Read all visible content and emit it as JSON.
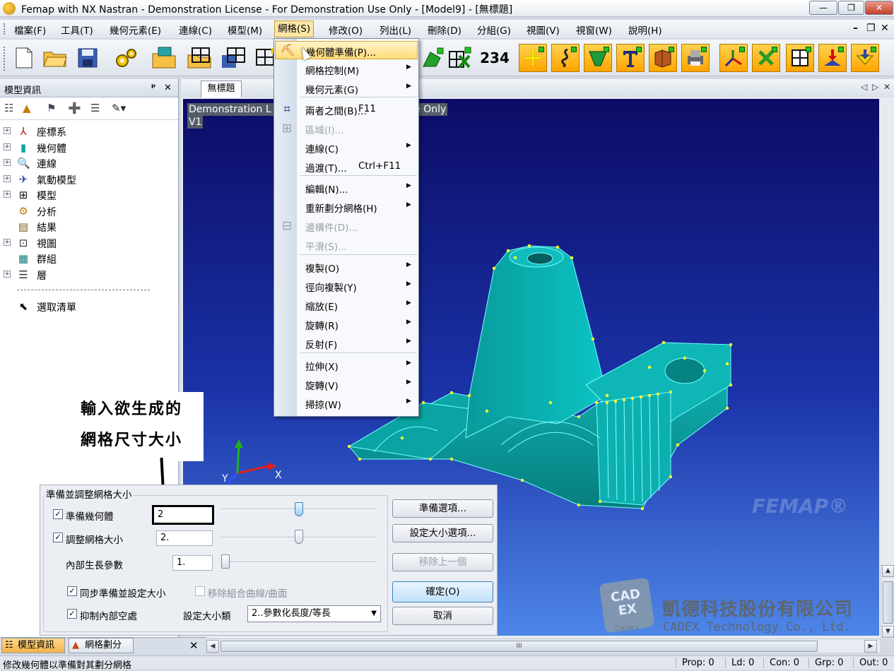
{
  "titlebar": {
    "title": "Femap with NX Nastran - Demonstration License - For Demonstration Use Only - [Model9] - [無標題]",
    "min": "—",
    "max": "❐",
    "close": "✕"
  },
  "menubar": {
    "items": [
      "檔案(F)",
      "工具(T)",
      "幾何元素(E)",
      "連線(C)",
      "模型(M)",
      "網格(S)",
      "修改(O)",
      "列出(L)",
      "刪除(D)",
      "分組(G)",
      "視圖(V)",
      "視窗(W)",
      "說明(H)"
    ],
    "active": "網格(S)",
    "mdi_min": "–",
    "mdi_restore": "❐",
    "mdi_close": "✕"
  },
  "toolbar": {
    "numbers_button": "234"
  },
  "left_panel": {
    "title": "模型資訊",
    "pin": "ᵖ",
    "close": "✕",
    "tree": [
      {
        "label": "座標系",
        "expandable": true
      },
      {
        "label": "幾何體",
        "expandable": true
      },
      {
        "label": "連線",
        "expandable": true
      },
      {
        "label": "氣動模型",
        "expandable": true
      },
      {
        "label": "模型",
        "expandable": true
      },
      {
        "label": "分析",
        "expandable": false
      },
      {
        "label": "結果",
        "expandable": false
      },
      {
        "label": "視圖",
        "expandable": true
      },
      {
        "label": "群組",
        "expandable": false
      },
      {
        "label": "層",
        "expandable": true
      },
      {
        "label": "",
        "separator": true
      },
      {
        "label": "選取清單",
        "expandable": false
      }
    ]
  },
  "viewport": {
    "tab": "無標題",
    "demo_line1": "Demonstration L",
    "demo_line1_right": "Use Only",
    "demo_line2": "V1",
    "axis_x": "X",
    "axis_y": "Y",
    "watermark": "FEMAP®",
    "colors": {
      "model": "#0aa8a8",
      "edges": "#ffff33"
    }
  },
  "mesh_menu": {
    "items": [
      {
        "label": "幾何體準備(P)...",
        "shortcut": "",
        "submenu": false,
        "disabled": false,
        "highlighted": true,
        "icon": "geometry-prep-icon"
      },
      {
        "label": "網格控制(M)",
        "shortcut": "",
        "submenu": true,
        "disabled": false
      },
      {
        "label": "幾何元素(G)",
        "shortcut": "",
        "submenu": true,
        "disabled": false
      },
      {
        "label": "兩者之間(B)...",
        "shortcut": "F11",
        "submenu": false,
        "disabled": false,
        "icon": "between-icon"
      },
      {
        "label": "區域(I)...",
        "shortcut": "",
        "submenu": false,
        "disabled": true,
        "icon": "region-icon"
      },
      {
        "label": "連線(C)",
        "shortcut": "",
        "submenu": true,
        "disabled": false
      },
      {
        "label": "過渡(T)...",
        "shortcut": "Ctrl+F11",
        "submenu": false,
        "disabled": false
      },
      {
        "label": "編輯(N)...",
        "shortcut": "",
        "submenu": true,
        "disabled": false
      },
      {
        "label": "重新劃分網格(H)",
        "shortcut": "",
        "submenu": true,
        "disabled": false
      },
      {
        "label": "邊構件(D)...",
        "shortcut": "",
        "submenu": false,
        "disabled": true,
        "icon": "edge-member-icon"
      },
      {
        "label": "平滑(S)...",
        "shortcut": "",
        "submenu": false,
        "disabled": true
      },
      {
        "label": "複製(O)",
        "shortcut": "",
        "submenu": true,
        "disabled": false
      },
      {
        "label": "徑向複製(Y)",
        "shortcut": "",
        "submenu": true,
        "disabled": false
      },
      {
        "label": "縮放(E)",
        "shortcut": "",
        "submenu": true,
        "disabled": false
      },
      {
        "label": "旋轉(R)",
        "shortcut": "",
        "submenu": true,
        "disabled": false
      },
      {
        "label": "反射(F)",
        "shortcut": "",
        "submenu": true,
        "disabled": false
      },
      {
        "label": "拉伸(X)",
        "shortcut": "",
        "submenu": true,
        "disabled": false
      },
      {
        "label": "旋轉(V)",
        "shortcut": "",
        "submenu": true,
        "disabled": false
      },
      {
        "label": "掃掠(W)",
        "shortcut": "",
        "submenu": true,
        "disabled": false
      }
    ]
  },
  "annotation": {
    "line1": "輸入欲生成的",
    "line2": "網格尺寸大小"
  },
  "dialog": {
    "group_title": "準備並調整網格大小",
    "prep_geometry": {
      "label": "準備幾何體",
      "checked": true,
      "value": "2",
      "slider_fraction": 0.5
    },
    "size_mesh": {
      "label": "調整網格大小",
      "checked": true,
      "value": "2.",
      "slider_fraction": 0.5
    },
    "growth": {
      "label": "內部生長參數",
      "value": "1.",
      "slider_fraction": 0.0
    },
    "sync": {
      "label": "同步準備並設定大小",
      "checked": true
    },
    "remove_combined": {
      "label": "移除組合曲線/曲面",
      "checked": false,
      "disabled": true
    },
    "suppress": {
      "label": "抑制內部空處",
      "checked": true
    },
    "sizing_type_label": "設定大小類",
    "sizing_type_value": "2..參數化長度/等長",
    "buttons": {
      "prep_options": "準備選項...",
      "size_options": "設定大小選項...",
      "remove_last": "移除上一個",
      "ok": "確定(O)",
      "cancel": "取消"
    }
  },
  "logo": {
    "mark": "CAD EX",
    "mark_small": "CADEX",
    "company_cn": "凱德科技股份有限公司",
    "company_en": "CADEX Technology Co., Ltd."
  },
  "bottom_tabs": {
    "tab1": "模型資訊",
    "tab2": "網格劃分",
    "close": "✕"
  },
  "statusbar": {
    "message": "修改幾何體以準備對其劃分網格",
    "prop": "Prop: 0",
    "ld": "Ld: 0",
    "con": "Con: 0",
    "grp": "Grp: 0",
    "out": "Out: 0"
  },
  "scroll": {
    "hthumb": "III"
  }
}
